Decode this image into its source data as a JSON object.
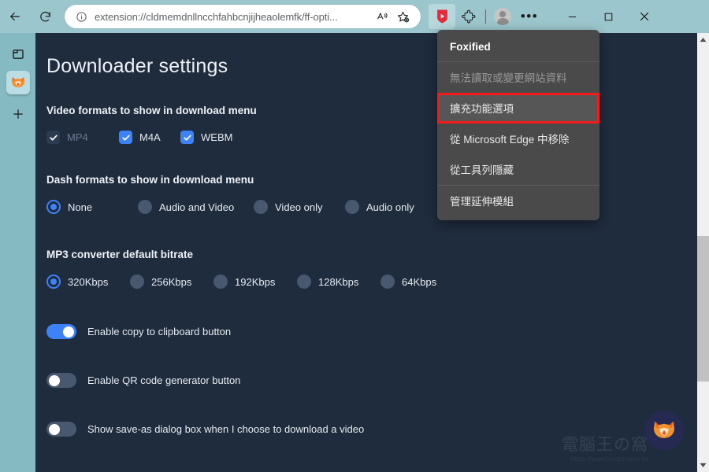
{
  "browser": {
    "back_label": "Back",
    "reload_label": "Refresh",
    "info_icon": "info-circle-icon",
    "url": "extension://cldmemdnllncchfahbcnjijheaolemfk/ff-opti...",
    "url_domain": "cldmemdnllncchfahbcnjijheaolemfk",
    "url_scheme": "extension://",
    "url_path": "/ff-opti...",
    "read_aloud_label": "Read aloud",
    "favorite_label": "Add this page to favorites",
    "extension_label": "Foxified",
    "extensions_label": "Extensions",
    "profile_label": "Profile",
    "settings_label": "Settings and more",
    "minimize_label": "Minimize",
    "maximize_label": "Restore",
    "close_label": "Close"
  },
  "sidebar": {
    "items": [
      {
        "name": "tab-actions-icon",
        "label": "Tab actions"
      },
      {
        "name": "foxified-tab-icon",
        "label": "Foxified"
      },
      {
        "name": "new-tab-icon",
        "label": "New tab"
      }
    ]
  },
  "menu": {
    "title": "Foxified",
    "items": [
      {
        "label": "無法讀取或變更網站資料",
        "state": "muted",
        "name": "menu-item-site-access"
      },
      {
        "label": "擴充功能選項",
        "state": "highlighted",
        "name": "menu-item-extension-options"
      },
      {
        "label": "從 Microsoft Edge 中移除",
        "state": "normal",
        "name": "menu-item-remove-from-edge"
      },
      {
        "label": "從工具列隱藏",
        "state": "normal",
        "name": "menu-item-hide-from-toolbar"
      },
      {
        "label": "管理延伸模組",
        "state": "normal",
        "name": "menu-item-manage-extensions"
      }
    ],
    "highlight_color": "#f51a1a"
  },
  "page": {
    "title": "Downloader settings",
    "accent_color": "#3d82f7",
    "background_color": "#1f2c3e",
    "sections": {
      "video_formats": {
        "label": "Video formats to show in download menu",
        "options": [
          {
            "label": "MP4",
            "checked": true,
            "disabled": true
          },
          {
            "label": "M4A",
            "checked": true,
            "disabled": false
          },
          {
            "label": "WEBM",
            "checked": true,
            "disabled": false
          }
        ]
      },
      "dash_formats": {
        "label": "Dash formats to show in download menu",
        "options": [
          {
            "label": "None",
            "selected": true
          },
          {
            "label": "Audio and Video",
            "selected": false
          },
          {
            "label": "Video only",
            "selected": false
          },
          {
            "label": "Audio only",
            "selected": false
          }
        ]
      },
      "mp3_bitrate": {
        "label": "MP3 converter default bitrate",
        "options": [
          {
            "label": "320Kbps",
            "selected": true
          },
          {
            "label": "256Kbps",
            "selected": false
          },
          {
            "label": "192Kbps",
            "selected": false
          },
          {
            "label": "128Kbps",
            "selected": false
          },
          {
            "label": "64Kbps",
            "selected": false
          }
        ]
      },
      "toggles": [
        {
          "label": "Enable copy to clipboard button",
          "on": true
        },
        {
          "label": "Enable QR code generator button",
          "on": false
        },
        {
          "label": "Show save-as dialog box when I choose to download a video",
          "on": false
        }
      ]
    },
    "fab_label": "Foxified",
    "watermark": {
      "title": "電腦王の窩",
      "url": "https://www.kocpc.com.tw"
    }
  }
}
